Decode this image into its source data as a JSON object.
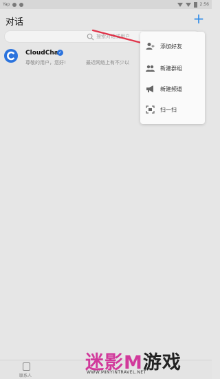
{
  "status_bar": {
    "carrier": "Yap",
    "time": "2:56"
  },
  "header": {
    "title": "对话",
    "plus_label": "+"
  },
  "search": {
    "placeholder": "搜索对话或用户"
  },
  "chats": [
    {
      "name": "CloudChat",
      "preview": "尊敬的用户，您好!",
      "date": "最近网络上有不少以"
    }
  ],
  "menu": {
    "items": [
      {
        "label": "添加好友",
        "icon": "add-friend-icon"
      },
      {
        "label": "新建群组",
        "icon": "group-icon"
      },
      {
        "label": "新建频道",
        "icon": "megaphone-icon"
      },
      {
        "label": "扫一扫",
        "icon": "scan-icon"
      }
    ]
  },
  "bottom_nav": {
    "contacts_label": "联系人"
  },
  "watermark": {
    "text_a": "迷影",
    "text_b": "M",
    "text_c": "游戏",
    "url": "WWW.MINYINTRAVEL.NET"
  },
  "colors": {
    "accent": "#2e8be8",
    "avatar": "#2b73dd",
    "arrow": "#e0344a",
    "watermark": "#d13a9b"
  }
}
